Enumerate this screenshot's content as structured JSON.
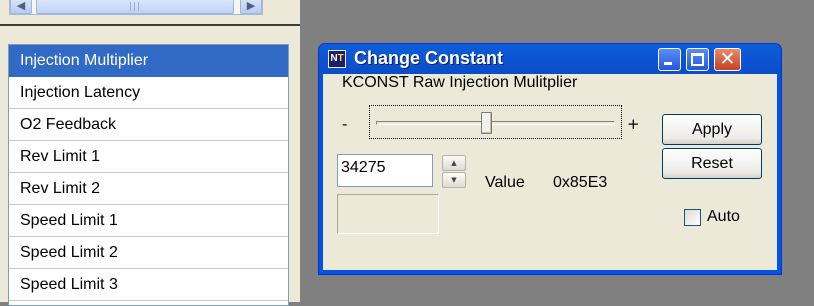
{
  "list": {
    "items": [
      "Injection Multiplier",
      "Injection Latency",
      "O2 Feedback",
      "Rev Limit 1",
      "Rev Limit 2",
      "Speed Limit 1",
      "Speed Limit 2",
      "Speed Limit 3"
    ],
    "selected_index": 0
  },
  "dialog": {
    "title": "Change Constant",
    "app_icon": "NT",
    "constant_label": "KCONST Raw Injection Mulitplier",
    "slider": {
      "min_label": "-",
      "max_label": "+",
      "level": 0.46
    },
    "value_input": "34275",
    "value_label": "Value",
    "hex_value": "0x85E3",
    "buttons": {
      "apply": "Apply",
      "reset": "Reset"
    },
    "auto": {
      "label": "Auto",
      "checked": false
    }
  },
  "icons": [
    "scroll-left-icon",
    "scroll-right-icon",
    "nt-app-icon",
    "minimize-icon",
    "maximize-icon",
    "close-icon",
    "spin-up-icon",
    "spin-down-icon"
  ],
  "colors": {
    "titlebar": "#0054e3",
    "selection": "#316ac5",
    "close": "#d7512f",
    "workspace": "#808080"
  }
}
